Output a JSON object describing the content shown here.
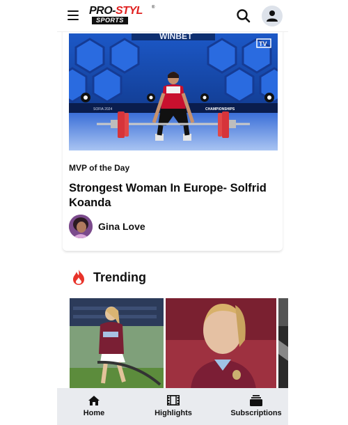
{
  "header": {
    "logo_line1_a": "PRO-",
    "logo_line1_b": "STYL",
    "logo_line2": "SPORTS",
    "logo_tm": "®"
  },
  "card": {
    "kicker": "MVP of the Day",
    "title": "Strongest Woman In Europe- Solfrid Koanda",
    "author": "Gina Love",
    "hero_banner_text": "WINBET",
    "hero_tv_badge": "TV",
    "hero_board_left": "SOFIA 2024",
    "hero_board_right": "CHAMPIONSHIPS"
  },
  "trending": {
    "title": "Trending"
  },
  "nav": {
    "items": [
      {
        "label": "Home",
        "icon": "home-icon"
      },
      {
        "label": "Highlights",
        "icon": "film-icon"
      },
      {
        "label": "Subscriptions",
        "icon": "subscriptions-icon"
      }
    ]
  },
  "colors": {
    "brand_red": "#e0201f",
    "nav_bg": "#e9ebef",
    "trend_icon": "#e8332a"
  }
}
